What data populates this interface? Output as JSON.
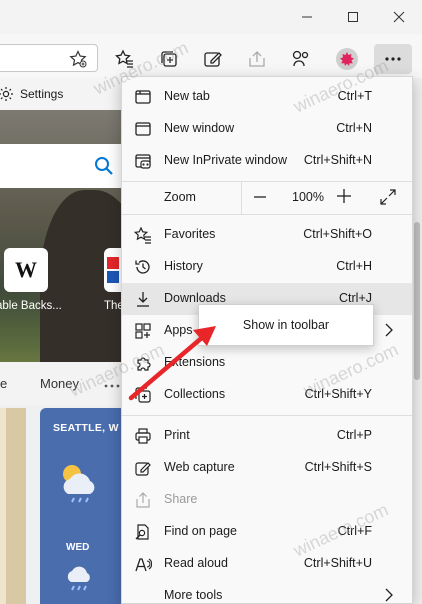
{
  "window": {
    "controls": [
      "minimize-icon",
      "maximize-icon",
      "close-icon"
    ]
  },
  "toolbar": {
    "icons": [
      "favorite-star-icon",
      "favorites-icon",
      "collections-icon",
      "web-capture-icon",
      "share-icon",
      "extensions-icon",
      "profile-avatar",
      "more-icon"
    ]
  },
  "page": {
    "settings_label": "Settings",
    "tiles": [
      {
        "label": "able Backs...",
        "icon": "W"
      },
      {
        "label": "The",
        "icon": ""
      }
    ],
    "feed_tabs": [
      "e",
      "Money"
    ],
    "weather": {
      "city": "SEATTLE, W",
      "day": "WED"
    }
  },
  "menu": {
    "items": [
      {
        "label": "New tab",
        "shortcut": "Ctrl+T",
        "icon": "new-tab-icon"
      },
      {
        "label": "New window",
        "shortcut": "Ctrl+N",
        "icon": "new-window-icon"
      },
      {
        "label": "New InPrivate window",
        "shortcut": "Ctrl+Shift+N",
        "icon": "inprivate-icon"
      },
      {
        "label": "Zoom",
        "value": "100%",
        "icon": ""
      },
      {
        "label": "Favorites",
        "shortcut": "Ctrl+Shift+O",
        "icon": "favorites-icon"
      },
      {
        "label": "History",
        "shortcut": "Ctrl+H",
        "icon": "history-icon"
      },
      {
        "label": "Downloads",
        "shortcut": "Ctrl+J",
        "icon": "downloads-icon"
      },
      {
        "label": "Apps",
        "shortcut": "",
        "icon": "apps-icon"
      },
      {
        "label": "Extensions",
        "shortcut": "",
        "icon": "extensions-icon"
      },
      {
        "label": "Collections",
        "shortcut": "Ctrl+Shift+Y",
        "icon": "collections-icon"
      },
      {
        "label": "Print",
        "shortcut": "Ctrl+P",
        "icon": "print-icon"
      },
      {
        "label": "Web capture",
        "shortcut": "Ctrl+Shift+S",
        "icon": "web-capture-icon"
      },
      {
        "label": "Share",
        "shortcut": "",
        "icon": "share-icon"
      },
      {
        "label": "Find on page",
        "shortcut": "Ctrl+F",
        "icon": "find-icon"
      },
      {
        "label": "Read aloud",
        "shortcut": "Ctrl+Shift+U",
        "icon": "read-aloud-icon"
      },
      {
        "label": "More tools",
        "shortcut": "",
        "icon": ""
      }
    ]
  },
  "tooltip": {
    "label": "Show in toolbar"
  },
  "watermark": "winaero.com",
  "colors": {
    "accent": "#0078d4",
    "arrow": "#e8262a",
    "weather_card": "#4a6dae",
    "profile": "#e0245e"
  }
}
